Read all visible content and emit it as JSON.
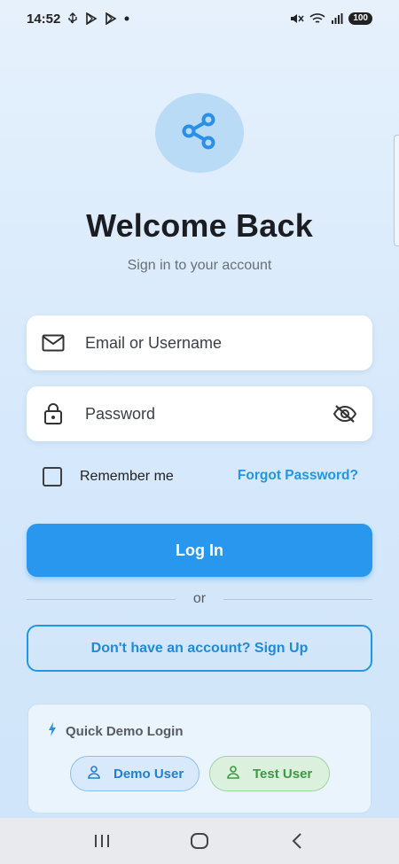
{
  "status_bar": {
    "time": "14:52",
    "battery": "100",
    "icons": [
      "usb-icon",
      "play-store-icon",
      "play-store-icon",
      "dot-icon",
      "mute-icon",
      "wifi-icon",
      "signal-icon",
      "battery-icon"
    ]
  },
  "logo": {
    "icon": "share-icon",
    "color": "#2a8fe6"
  },
  "header": {
    "title": "Welcome Back",
    "subtitle": "Sign in to your account"
  },
  "form": {
    "email": {
      "placeholder": "Email or Username",
      "value": "",
      "icon": "mail-icon"
    },
    "password": {
      "placeholder": "Password",
      "value": "",
      "icon": "lock-icon",
      "toggle_icon": "eye-off-icon"
    },
    "remember_label": "Remember me",
    "remember_checked": false,
    "forgot_label": "Forgot Password?",
    "login_label": "Log In",
    "divider_text": "or",
    "signup_label": "Don't have an account? Sign Up"
  },
  "demo": {
    "title": "Quick Demo Login",
    "icon": "bolt-icon",
    "buttons": [
      {
        "label": "Demo User",
        "icon": "person-icon",
        "color": "#1f7fd0"
      },
      {
        "label": "Test User",
        "icon": "person-icon",
        "color": "#3b9a41"
      }
    ]
  },
  "colors": {
    "accent": "#2a97ef",
    "link": "#2196e3"
  }
}
